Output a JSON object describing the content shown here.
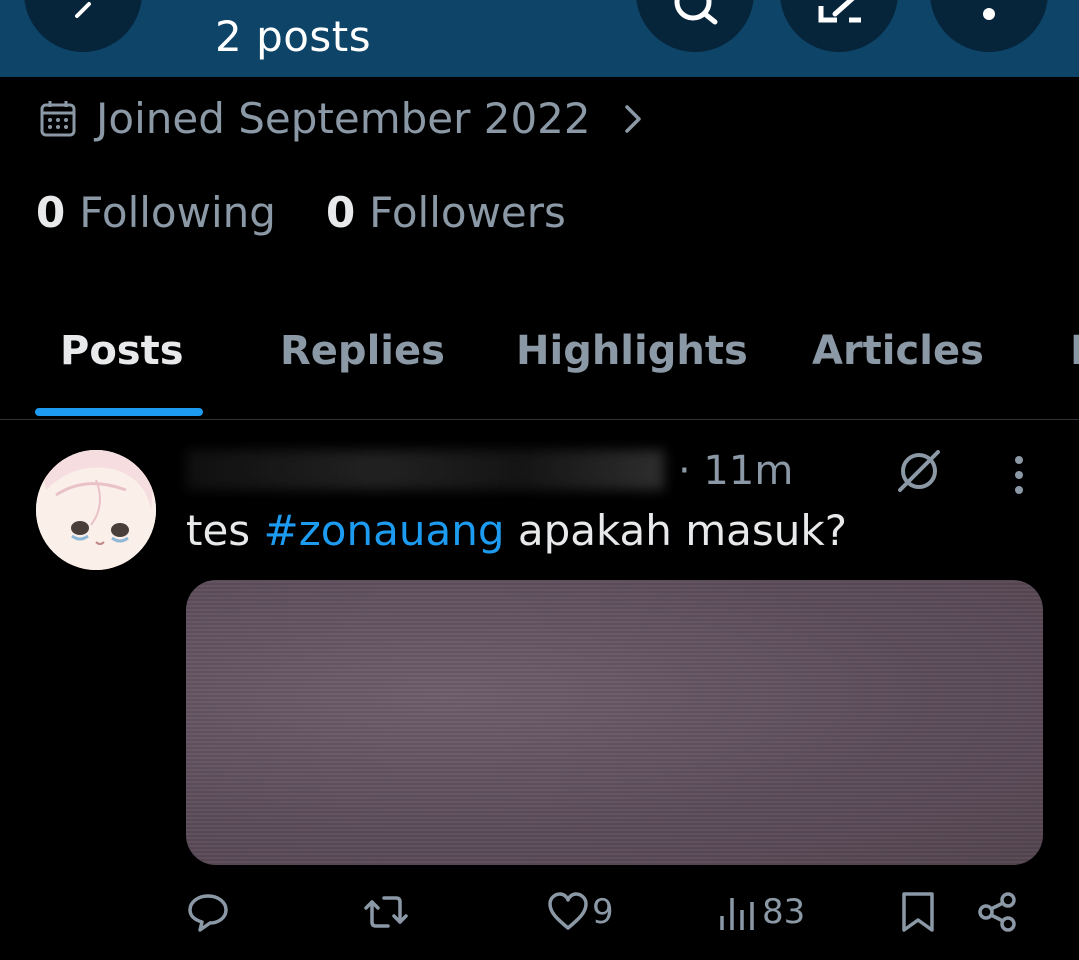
{
  "header": {
    "title": "2 posts"
  },
  "profile": {
    "joined": "Joined September 2022",
    "following_count": "0",
    "following_label": "Following",
    "followers_count": "0",
    "followers_label": "Followers"
  },
  "tabs": [
    {
      "label": "Posts",
      "active": true
    },
    {
      "label": "Replies",
      "active": false
    },
    {
      "label": "Highlights",
      "active": false
    },
    {
      "label": "Articles",
      "active": false
    },
    {
      "label": "M",
      "active": false
    }
  ],
  "post": {
    "time": "· 11m",
    "text_before": "tes ",
    "hashtag": "#zonauang",
    "text_after": " apakah masuk?",
    "likes": "9",
    "views": "83"
  },
  "colors": {
    "header_bg": "#0d4467",
    "accent": "#1d9bf0",
    "muted_text": "#8b98a5",
    "primary_text": "#e7e9ea"
  }
}
